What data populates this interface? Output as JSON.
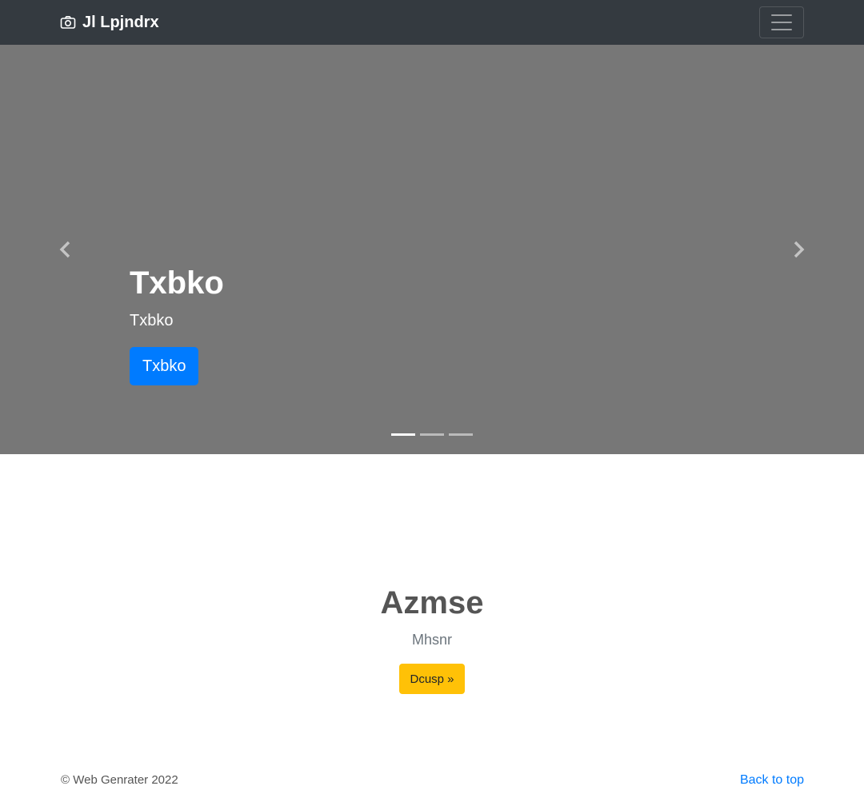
{
  "navbar": {
    "brand_text": "Jl Lpjndrx",
    "brand_icon": "camera-icon",
    "toggler_icon": "hamburger-menu-icon",
    "background": "#343a40"
  },
  "carousel": {
    "background": "#777777",
    "prev_icon": "chevron-left-icon",
    "next_icon": "chevron-right-icon",
    "heading": "Txbko",
    "subtext": "Txbko",
    "button_label": "Txbko",
    "button_color": "#007bff",
    "indicators": [
      {
        "active": true
      },
      {
        "active": false
      },
      {
        "active": false
      }
    ]
  },
  "feature": {
    "heading": "Azmse",
    "lead": "Mhsnr",
    "button_label": "Dcusp »",
    "button_color": "#ffc107"
  },
  "footer": {
    "copyright": "© Web Genrater 2022",
    "back_to_top": "Back to top",
    "link_color": "#007bff"
  }
}
